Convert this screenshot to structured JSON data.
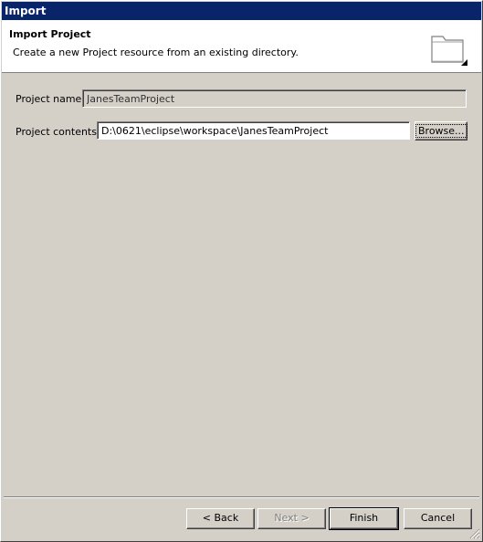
{
  "window": {
    "title": "Import"
  },
  "banner": {
    "title": "Import Project",
    "description": "Create a new Project resource from an existing directory.",
    "icon": "folder-icon"
  },
  "form": {
    "project_name_label": "Project name:",
    "project_name_value": "JanesTeamProject",
    "project_contents_label": "Project contents:",
    "project_contents_value": "D:\\0621\\eclipse\\workspace\\JanesTeamProject",
    "browse_label": "Browse..."
  },
  "buttons": {
    "back": "< Back",
    "next": "Next >",
    "finish": "Finish",
    "cancel": "Cancel"
  }
}
